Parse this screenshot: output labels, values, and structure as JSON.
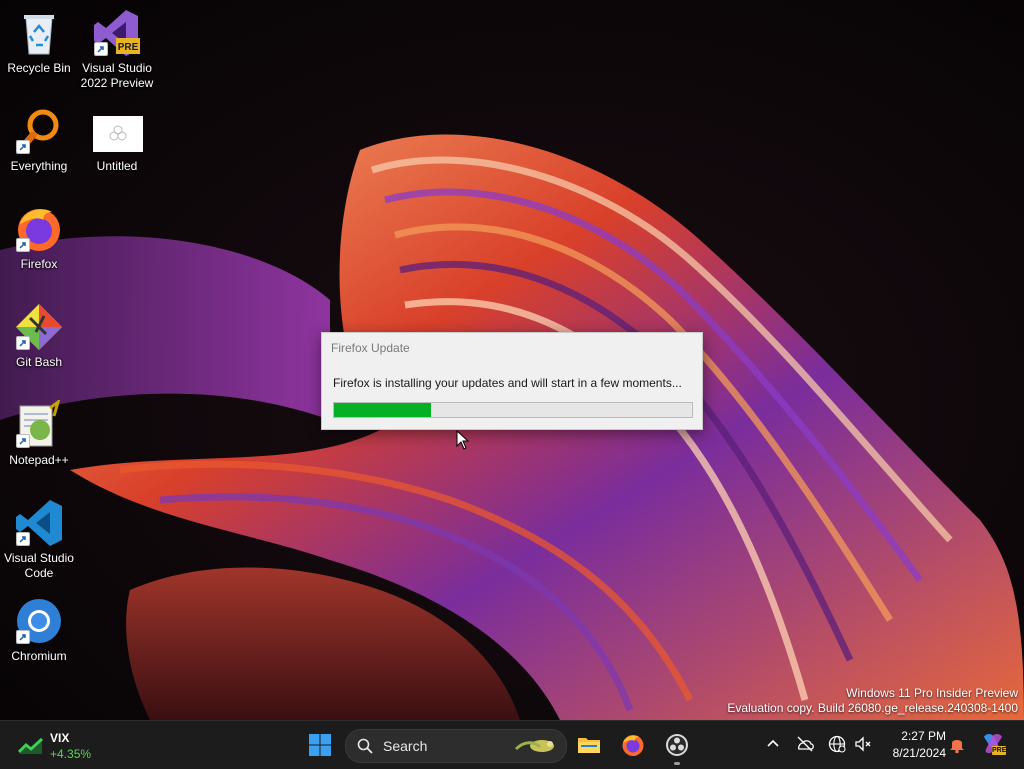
{
  "desktop": {
    "icons": [
      {
        "label": "Recycle Bin"
      },
      {
        "label": "Visual Studio 2022 Preview",
        "badge": "PRE"
      },
      {
        "label": "Everything"
      },
      {
        "label": "Untitled"
      },
      {
        "label": "Firefox"
      },
      {
        "label": "Git Bash"
      },
      {
        "label": "Notepad++"
      },
      {
        "label": "Visual Studio Code"
      },
      {
        "label": "Chromium"
      }
    ]
  },
  "dialog": {
    "title": "Firefox Update",
    "message": "Firefox is installing your updates and will start in a few moments...",
    "progress_percent": 27
  },
  "watermark": {
    "line1": "Windows 11 Pro Insider Preview",
    "line2": "Evaluation copy. Build 26080.ge_release.240308-1400"
  },
  "taskbar": {
    "widget": {
      "name": "VIX",
      "change": "+4.35%"
    },
    "search_placeholder": "Search",
    "pinned": [
      "start-icon",
      "file-explorer-icon",
      "firefox-icon",
      "obs-icon"
    ],
    "clock": {
      "time": "2:27 PM",
      "date": "8/21/2024"
    },
    "copilot_badge": "PRE"
  },
  "colors": {
    "progress": "#06b025",
    "taskbar": "#1c1c1c",
    "dialog_bg": "#f0f0f0",
    "widget_change": "#5dd35d"
  }
}
